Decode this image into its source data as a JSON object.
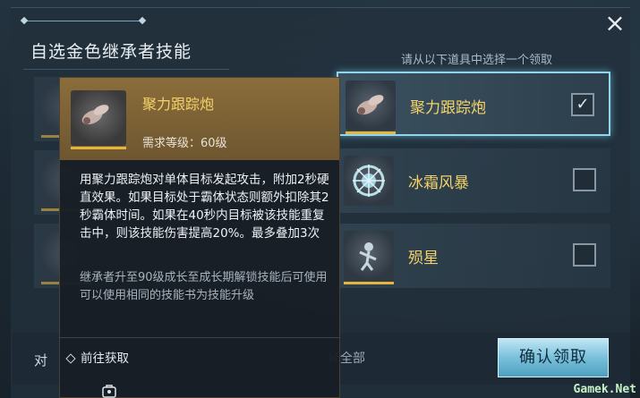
{
  "dialog": {
    "title": "自选金色继承者技能",
    "hint": "请从以下道具中选择一个领取",
    "close_icon": "×"
  },
  "skills": [
    {
      "name": "聚力跟踪炮",
      "selected": true,
      "checkmark": "✓",
      "icon": "cannon-icon"
    },
    {
      "name": "冰霜风暴",
      "selected": false,
      "checkmark": "",
      "icon": "frost-storm-icon"
    },
    {
      "name": "殒星",
      "selected": false,
      "checkmark": "",
      "icon": "meteor-icon"
    }
  ],
  "tooltip": {
    "name": "聚力跟踪炮",
    "level_req": "需求等级：60级",
    "description": "用聚力跟踪炮对单体目标发起攻击，附加2秒硬直效果。如果目标处于霸体状态则额外扣除其2秒霸体时间。如果在40秒内目标被该技能重复击中，则该技能伤害提高20%。最多叠加3次",
    "note": "继承者升至90级成长至成长期解锁技能后可使用\n可以使用相同的技能书为技能升级",
    "get_label": "前往获取"
  },
  "footer": {
    "left_label": "对",
    "select_all": "择全部",
    "confirm": "确认领取"
  },
  "watermark": "Gamek.Net",
  "colors": {
    "gold_text": "#f5d36b",
    "selected_border": "#8fd5ec",
    "confirm_bg": "#79c0db"
  }
}
